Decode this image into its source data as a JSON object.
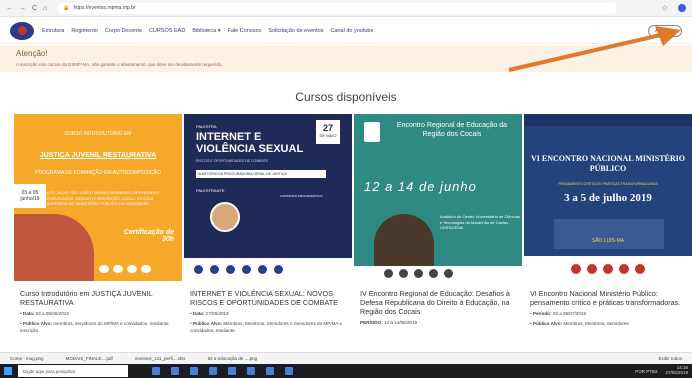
{
  "browser": {
    "url": "https://eventos.mpma.mp.br",
    "back_icon": "←",
    "forward_icon": "→",
    "reload_icon": "C",
    "home_icon": "⌂",
    "star_icon": "☆"
  },
  "nav": {
    "items": [
      "Estrutura",
      "Regimento",
      "Corpo Docente",
      "CURSOS EAD",
      "Biblioteca ▾",
      "Fale Conosco",
      "Solicitação de eventos",
      "Canal do youtube"
    ],
    "login_button": "Acessar"
  },
  "alert": {
    "title": "Atenção!",
    "message": "A inscrição nos cursos da ESMP-MA, não garante o afastamento, que deve ser devidamente requerido."
  },
  "section_title": "Cursos disponíveis",
  "courses": [
    {
      "banner_top": "CURSO INTRODUTÓRIO EM",
      "banner_heading": "JUSTIÇA JUVENIL RESTAURATIVA",
      "banner_subheading": "PROGRAMA DE FORMAÇÃO EM AUTOCOMPOSIÇÃO",
      "banner_info": "PÚBLICO - ALVO: SÃO LUÍS E DEMAIS MEMBROS, SERVIDORES E CONVIDADOS, MEDIANTE INSCRIÇÃO. LOCAL: ESCOLA SUPERIOR DO MINISTÉRIO PÚBLICO DO MARANHÃO",
      "banner_date": "03 a 05 junho/19",
      "banner_cert": "Certificação de 30h",
      "title": "Curso Introdutório em JUSTIÇA JUVENIL RESTAURATIVA",
      "date_label": "Data:",
      "date": "03 a 05/06/2019",
      "audience_label": "Público Alvo:",
      "audience": "membros, servidores do MP/MA e convidados, mediante inscrição"
    },
    {
      "banner_small": "PALESTRA",
      "banner_heading": "INTERNET E VIOLÊNCIA SEXUAL",
      "banner_sub": "RISCOS E OPORTUNIDADES DE COMBATE",
      "banner_pill": "AUDITÓRIO DA PROCURADORIA GERAL DE JUSTIÇA",
      "banner_day": "27",
      "banner_month": "DE MAIO",
      "banner_palestrante": "PALESTRANTE",
      "banner_prog": "CONTEÚDO PROGRAMÁTICO",
      "title": "INTERNET E VIOLÊNCIA SEXUAL: NOVOS RISCOS E OPORTUNIDADES DE COMBATE",
      "date_label": "Data:",
      "date": "27/05/2019",
      "audience_label": "Público Alvo:",
      "audience": "Membros, Membros, Servidores e Servidores do MP/MA e convidados, mediante"
    },
    {
      "banner_heading": "Encontro Regional de Educação da Região dos Cocais",
      "banner_script": "12 a 14 de junho",
      "banner_loc": "Auditório do Centro Universitário de Ciências e Tecnologias do Maranhão de Caxias - UNIFACEMA",
      "title": "IV Encontro Regional de Educação: Desafios à Defesa Republicana do Direito à Educação, na Região dos Cocais",
      "date_label": "PERÍODO:",
      "date": "12 a 14/06/2019"
    },
    {
      "banner_heading": "VI ENCONTRO NACIONAL MINISTÉRIO PÚBLICO",
      "banner_tag": "PENSAMENTO CRÍTICO E PRÁTICAS TRANSFORMADORAS",
      "banner_date": "3 a 5 de julho 2019",
      "banner_place": "SÃO LUÍS-MA",
      "title": "VI Encontro Nacional Ministério Público: pensamento crítico e práticas transformadoras.",
      "date_label": "Período:",
      "date": "03 a 05/07/2019",
      "audience_label": "Público Alvo:",
      "audience": "Membros, Membros, Servidores"
    }
  ],
  "downloads": {
    "items": [
      "Comp - mug.png",
      "MODAIS_FINALE....pdf",
      "monsesl_131_perfi....xlsx",
      "52 a educação de ....png"
    ],
    "show_all": "Exibir todos"
  },
  "taskbar": {
    "search_placeholder": "Digite aqui para pesquisar",
    "lang": "POR PTB2",
    "time": "14:16",
    "date": "27/05/2019"
  },
  "colors": {
    "alert_bg": "#fdf1e5",
    "card1_bg": "#f6a829",
    "card2_bg": "#1e2a57",
    "card3_bg": "#2e8a83",
    "card4_bg": "#24427c",
    "arrow": "#e07a2a"
  }
}
